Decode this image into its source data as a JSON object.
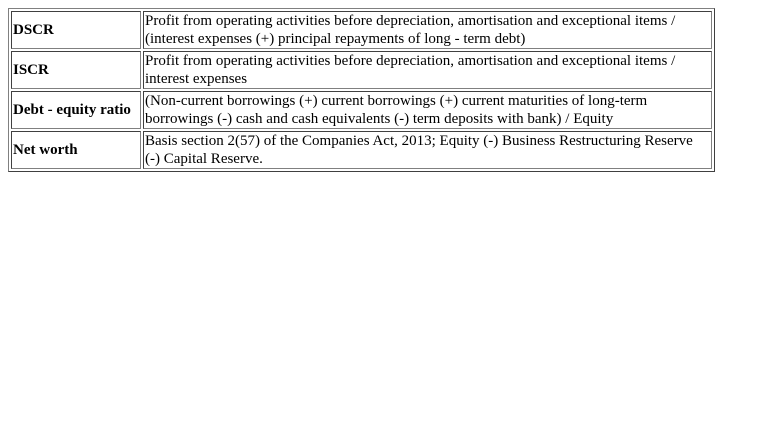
{
  "rows": [
    {
      "term": "DSCR",
      "definition": "Profit from operating activities before depreciation, amortisation and exceptional items / (interest expenses (+) principal repayments of long - term debt)"
    },
    {
      "term": "ISCR",
      "definition": "Profit from operating activities before depreciation, amortisation and exceptional items / interest expenses"
    },
    {
      "term": "Debt - equity ratio",
      "definition": "(Non-current borrowings (+) current borrowings (+) current maturities of long-term borrowings (-) cash and cash equivalents (-) term deposits with bank) / Equity"
    },
    {
      "term": "Net worth",
      "definition": "Basis section 2(57) of the Companies Act, 2013; Equity (-) Business Restructuring Reserve (-) Capital Reserve."
    }
  ]
}
